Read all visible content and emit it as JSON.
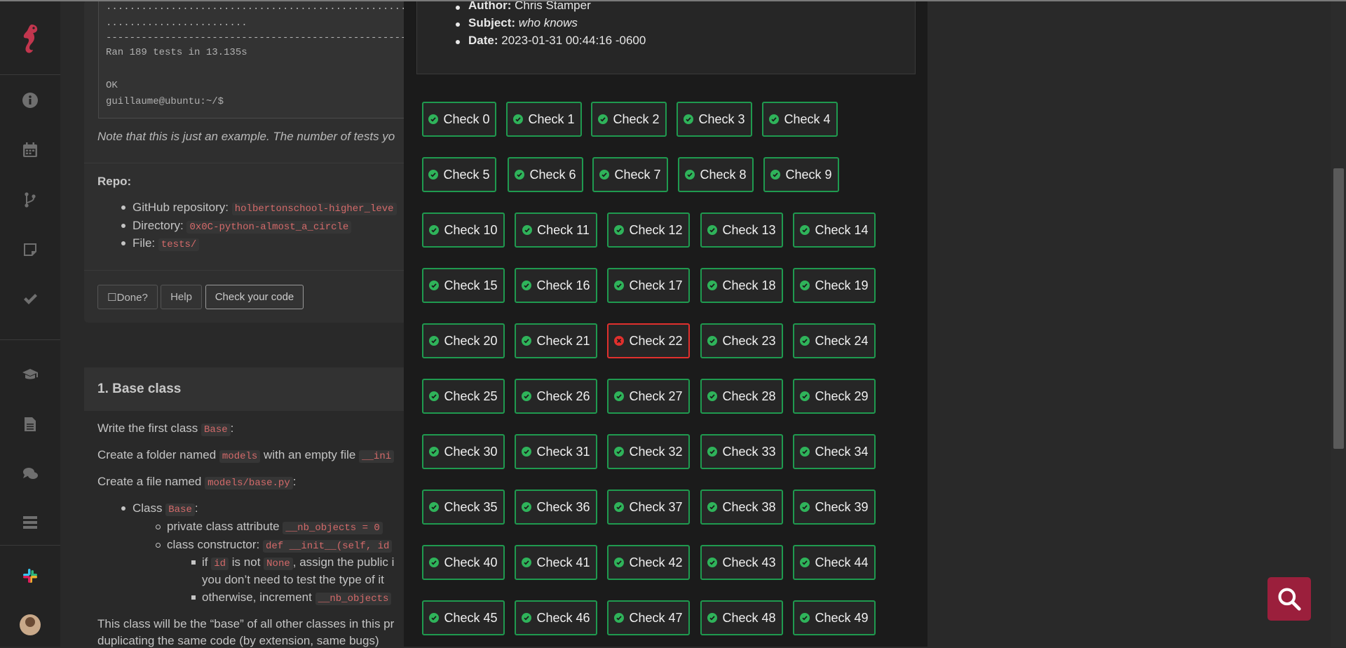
{
  "commit": {
    "author_label": "Author:",
    "author_value": "Chris Stamper",
    "subject_label": "Subject:",
    "subject_value": "who knows",
    "date_label": "Date:",
    "date_value": "2023-01-31 00:44:16 -0600"
  },
  "checks": [
    {
      "label": "Check 0",
      "status": "pass"
    },
    {
      "label": "Check 1",
      "status": "pass"
    },
    {
      "label": "Check 2",
      "status": "pass"
    },
    {
      "label": "Check 3",
      "status": "pass"
    },
    {
      "label": "Check 4",
      "status": "pass"
    },
    {
      "label": "Check 5",
      "status": "pass"
    },
    {
      "label": "Check 6",
      "status": "pass"
    },
    {
      "label": "Check 7",
      "status": "pass"
    },
    {
      "label": "Check 8",
      "status": "pass"
    },
    {
      "label": "Check 9",
      "status": "pass"
    },
    {
      "label": "Check 10",
      "status": "pass"
    },
    {
      "label": "Check 11",
      "status": "pass"
    },
    {
      "label": "Check 12",
      "status": "pass"
    },
    {
      "label": "Check 13",
      "status": "pass"
    },
    {
      "label": "Check 14",
      "status": "pass"
    },
    {
      "label": "Check 15",
      "status": "pass"
    },
    {
      "label": "Check 16",
      "status": "pass"
    },
    {
      "label": "Check 17",
      "status": "pass"
    },
    {
      "label": "Check 18",
      "status": "pass"
    },
    {
      "label": "Check 19",
      "status": "pass"
    },
    {
      "label": "Check 20",
      "status": "pass"
    },
    {
      "label": "Check 21",
      "status": "pass"
    },
    {
      "label": "Check 22",
      "status": "fail"
    },
    {
      "label": "Check 23",
      "status": "pass"
    },
    {
      "label": "Check 24",
      "status": "pass"
    },
    {
      "label": "Check 25",
      "status": "pass"
    },
    {
      "label": "Check 26",
      "status": "pass"
    },
    {
      "label": "Check 27",
      "status": "pass"
    },
    {
      "label": "Check 28",
      "status": "pass"
    },
    {
      "label": "Check 29",
      "status": "pass"
    },
    {
      "label": "Check 30",
      "status": "pass"
    },
    {
      "label": "Check 31",
      "status": "pass"
    },
    {
      "label": "Check 32",
      "status": "pass"
    },
    {
      "label": "Check 33",
      "status": "pass"
    },
    {
      "label": "Check 34",
      "status": "pass"
    },
    {
      "label": "Check 35",
      "status": "pass"
    },
    {
      "label": "Check 36",
      "status": "pass"
    },
    {
      "label": "Check 37",
      "status": "pass"
    },
    {
      "label": "Check 38",
      "status": "pass"
    },
    {
      "label": "Check 39",
      "status": "pass"
    },
    {
      "label": "Check 40",
      "status": "pass"
    },
    {
      "label": "Check 41",
      "status": "pass"
    },
    {
      "label": "Check 42",
      "status": "pass"
    },
    {
      "label": "Check 43",
      "status": "pass"
    },
    {
      "label": "Check 44",
      "status": "pass"
    },
    {
      "label": "Check 45",
      "status": "pass"
    },
    {
      "label": "Check 46",
      "status": "pass"
    },
    {
      "label": "Check 47",
      "status": "pass"
    },
    {
      "label": "Check 48",
      "status": "pass"
    },
    {
      "label": "Check 49",
      "status": "pass"
    }
  ],
  "terminal": {
    "dots1": "..........................................................",
    "dots2": "........................",
    "dashes": "-----------------------------------------------------------",
    "ran": "Ran 189 tests in 13.135s",
    "ok": "OK",
    "prompt": "guillaume@ubuntu:~/$"
  },
  "note": "Note that this is just an example. The number of tests yo",
  "repo": {
    "title": "Repo:",
    "github_label": "GitHub repository:",
    "github_value": "holbertonschool-higher_leve",
    "directory_label": "Directory:",
    "directory_value": "0x0C-python-almost_a_circle",
    "file_label": "File:",
    "file_value": "tests/"
  },
  "buttons": {
    "done": "☐Done?",
    "help": "Help",
    "check_code": "Check your code"
  },
  "section": {
    "title": "1. Base class",
    "write_pre": "Write the first class",
    "write_code": "Base",
    "write_post": ":",
    "folder_pre": "Create a folder named",
    "folder_code": "models",
    "folder_mid": "with an empty file",
    "folder_code2": "__ini",
    "file_pre": "Create a file named",
    "file_code": "models/base.py",
    "file_post": ":",
    "class_pre": "Class",
    "class_code": "Base",
    "class_post": ":",
    "attr_pre": "private class attribute",
    "attr_code": "__nb_objects = 0",
    "ctor_pre": "class constructor:",
    "ctor_code": "def __init__(self, id",
    "if_pre": "if",
    "if_code": "id",
    "if_mid": "is not",
    "if_code2": "None",
    "if_post": ", assign the public i",
    "if_line2": "you don’t need to test the type of it",
    "else_pre": "otherwise, increment",
    "else_code": "__nb_objects",
    "para1": "This class will be the “base” of all other classes in this pr",
    "para2": "duplicating the same code (by extension, same bugs)"
  },
  "colors": {
    "pass": "#1f9a4f",
    "fail": "#e0302d",
    "brand": "#9b1f3c"
  }
}
